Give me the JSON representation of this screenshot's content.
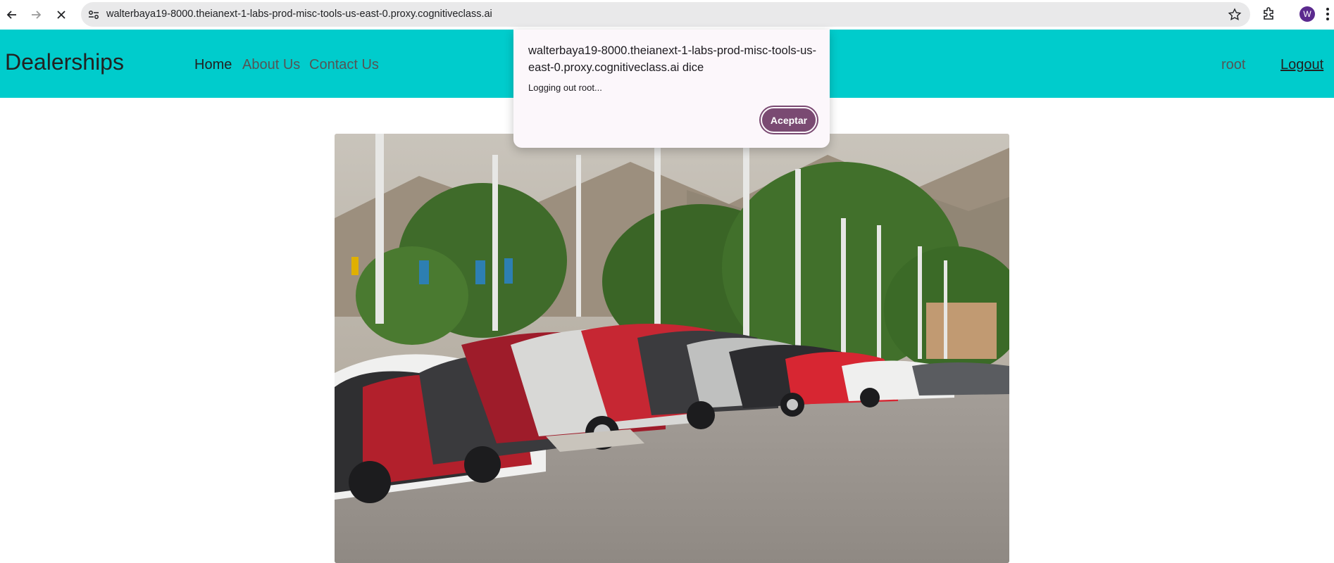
{
  "browser": {
    "url": "walterbaya19-8000.theianext-1-labs-prod-misc-tools-us-east-0.proxy.cognitiveclass.ai",
    "profile_initial": "W",
    "back_icon": "arrow-left-icon",
    "forward_icon": "arrow-right-icon",
    "stop_icon": "close-icon"
  },
  "header": {
    "brand": "Dealerships",
    "nav": [
      {
        "label": "Home"
      },
      {
        "label": "About Us"
      },
      {
        "label": "Contact Us"
      }
    ],
    "user": "root",
    "logout": "Logout"
  },
  "dialog": {
    "title": "walterbaya19-8000.theianext-1-labs-prod-misc-tools-us-east-0.proxy.cognitiveclass.ai dice",
    "message": "Logging out root...",
    "button": "Aceptar"
  },
  "colors": {
    "header_bg": "#00cccc",
    "dialog_button": "#7a4a72",
    "avatar": "#5b2a8e"
  }
}
